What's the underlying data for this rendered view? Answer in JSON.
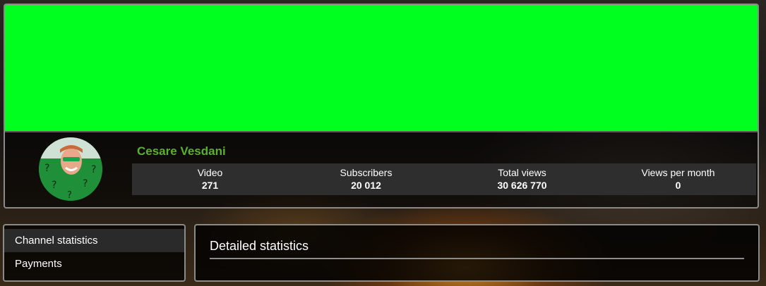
{
  "profile": {
    "banner_color": "#00ff1e",
    "channel_name": "Cesare Vesdani",
    "name_color": "#5ab030",
    "avatar_icon": "riddler-avatar-icon"
  },
  "stats": [
    {
      "label": "Video",
      "value": "271"
    },
    {
      "label": "Subscribers",
      "value": "20 012"
    },
    {
      "label": "Total views",
      "value": "30 626 770"
    },
    {
      "label": "Views per month",
      "value": "0"
    }
  ],
  "nav": {
    "items": [
      {
        "label": "Channel statistics",
        "active": true
      },
      {
        "label": "Payments",
        "active": false
      }
    ]
  },
  "detail": {
    "title": "Detailed statistics"
  }
}
